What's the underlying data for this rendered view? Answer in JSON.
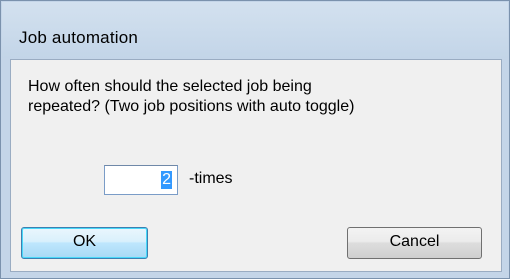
{
  "window": {
    "title": "Job automation"
  },
  "message": {
    "line1": "How often should the selected job being",
    "line2": "repeated? (Two job positions with auto toggle)"
  },
  "repeat": {
    "value": "2",
    "unit_label": "-times"
  },
  "buttons": {
    "ok_label": "OK",
    "cancel_label": "Cancel"
  },
  "colors": {
    "dialog_frame": "#c4d5e8",
    "client_background": "#f0f0f0",
    "selection_highlight": "#3399ff",
    "default_button_border": "#3c7fb1"
  }
}
